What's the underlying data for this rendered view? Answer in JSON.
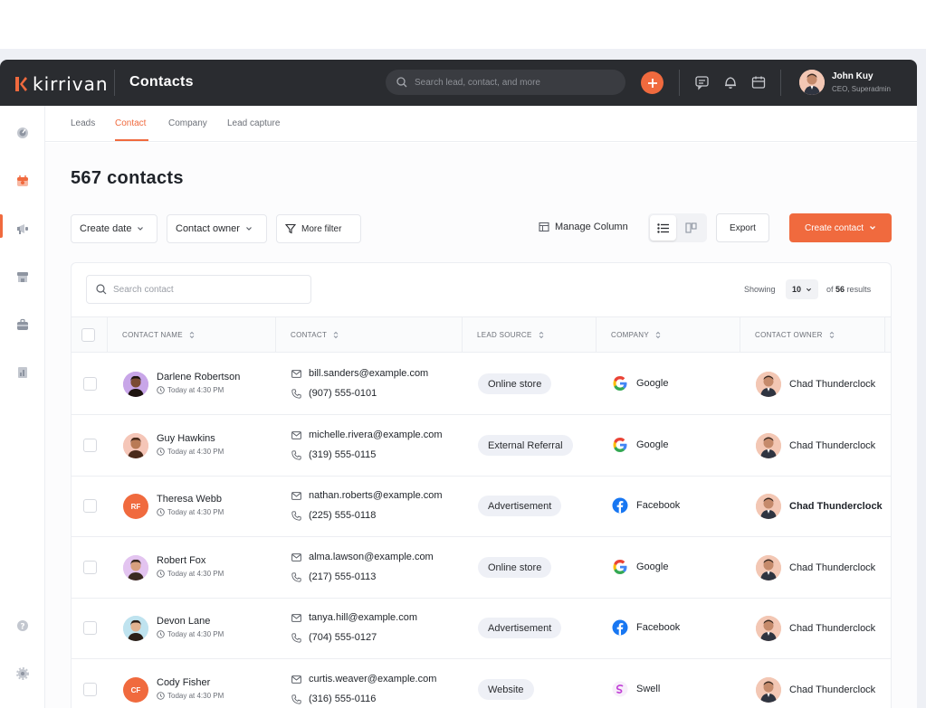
{
  "app": {
    "brand": "kirrivan",
    "page_title": "Contacts",
    "accent_color": "#f06a3e"
  },
  "search": {
    "placeholder": "Search lead, contact, and more"
  },
  "user": {
    "name": "John Kuy",
    "role": "CEO, Superadmin"
  },
  "tabs": [
    {
      "label": "Leads",
      "active": false
    },
    {
      "label": "Contact",
      "active": true
    },
    {
      "label": "Company",
      "active": false
    },
    {
      "label": "Lead capture",
      "active": false
    }
  ],
  "main": {
    "heading": "567 contacts",
    "filters": {
      "create_date": "Create date",
      "contact_owner": "Contact owner",
      "more_filter": "More filter"
    },
    "manage_column": "Manage Column",
    "export": "Export",
    "create_contact": "Create contact"
  },
  "table": {
    "search_placeholder": "Search contact",
    "showing_label": "Showing",
    "page_size": "10",
    "results_of": "of",
    "results_count": "56",
    "results_label": "results",
    "columns": [
      "CONTACT NAME",
      "CONTACT",
      "LEAD SOURCE",
      "COMPANY",
      "CONTACT OWNER"
    ],
    "rows": [
      {
        "name": "Darlene Robertson",
        "time": "Today at 4:30 PM",
        "email": "bill.sanders@example.com",
        "phone": "(907) 555-0101",
        "source": "Online store",
        "company": "Google",
        "company_icon": "google-icon",
        "owner": "Chad Thunderclock",
        "avatar": "photo",
        "avatar_color": "#c8a6e8",
        "initials": ""
      },
      {
        "name": "Guy Hawkins",
        "time": "Today at 4:30 PM",
        "email": "michelle.rivera@example.com",
        "phone": "(319) 555-0115",
        "source": "External Referral",
        "company": "Google",
        "company_icon": "google-icon",
        "owner": "Chad Thunderclock",
        "avatar": "photo",
        "avatar_color": "#f5c6b8",
        "initials": ""
      },
      {
        "name": "Theresa Webb",
        "time": "Today at 4:30 PM",
        "email": "nathan.roberts@example.com",
        "phone": "(225) 555-0118",
        "source": "Advertisement",
        "company": "Facebook",
        "company_icon": "facebook-icon",
        "owner": "Chad Thunderclock",
        "avatar": "initials",
        "avatar_color": "#f06a3e",
        "initials": "RF"
      },
      {
        "name": "Robert Fox",
        "time": "Today at 4:30 PM",
        "email": "alma.lawson@example.com",
        "phone": "(217) 555-0113",
        "source": "Online store",
        "company": "Google",
        "company_icon": "google-icon",
        "owner": "Chad Thunderclock",
        "avatar": "photo",
        "avatar_color": "#e3c4f0",
        "initials": ""
      },
      {
        "name": "Devon Lane",
        "time": "Today at 4:30 PM",
        "email": "tanya.hill@example.com",
        "phone": "(704) 555-0127",
        "source": "Advertisement",
        "company": "Facebook",
        "company_icon": "facebook-icon",
        "owner": "Chad Thunderclock",
        "avatar": "photo",
        "avatar_color": "#bfe3ef",
        "initials": ""
      },
      {
        "name": "Cody Fisher",
        "time": "Today at 4:30 PM",
        "email": "curtis.weaver@example.com",
        "phone": "(316) 555-0116",
        "source": "Website",
        "company": "Swell",
        "company_icon": "swell-icon",
        "owner": "Chad Thunderclock",
        "avatar": "initials",
        "avatar_color": "#f06a3e",
        "initials": "CF"
      }
    ]
  }
}
